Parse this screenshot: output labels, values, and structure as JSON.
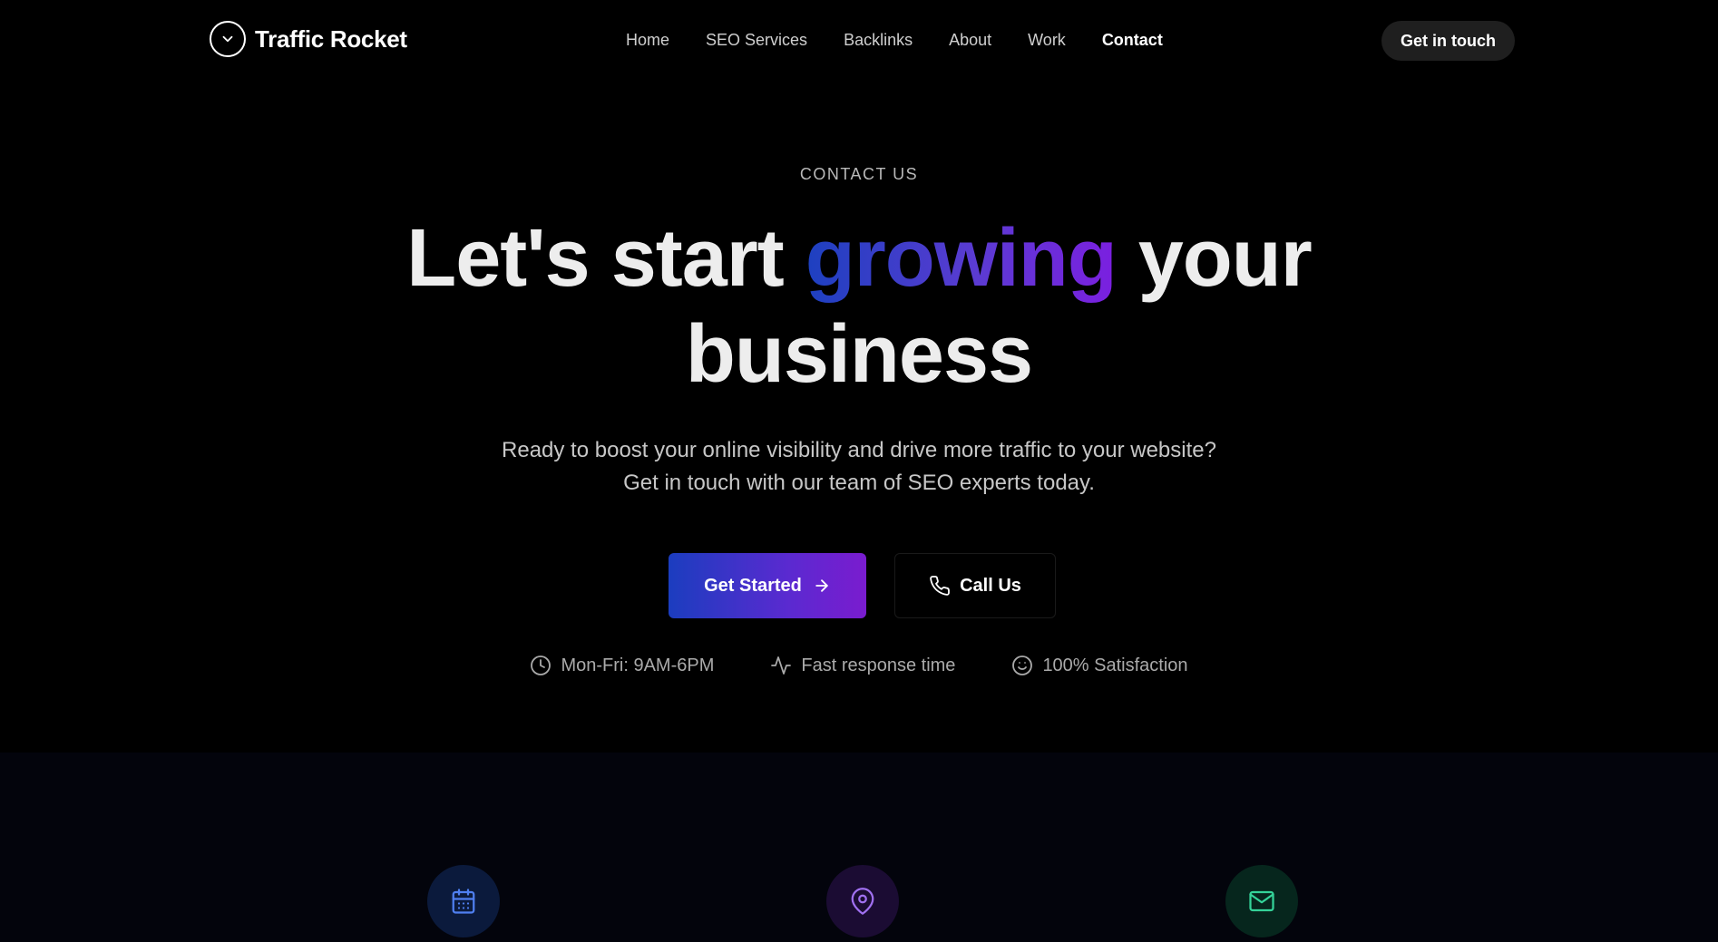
{
  "brand": {
    "name": "Traffic Rocket",
    "icon": "chevron-down-circle-icon"
  },
  "nav": {
    "links": [
      "Home",
      "SEO Services",
      "Backlinks",
      "About",
      "Work",
      "Contact"
    ],
    "active": "Contact",
    "cta_label": "Get in touch"
  },
  "hero": {
    "eyebrow": "CONTACT US",
    "headline_prefix": "Let's start ",
    "headline_highlight": "growing",
    "headline_suffix_1": " your",
    "headline_line2": "business",
    "subtitle_line1": "Ready to boost your online visibility and drive more traffic to your website?",
    "subtitle_line2": "Get in touch with our team of SEO experts today.",
    "primary_button": "Get Started",
    "secondary_button": "Call Us",
    "meta": [
      {
        "icon": "clock-icon",
        "label": "Mon-Fri: 9AM-6PM"
      },
      {
        "icon": "activity-icon",
        "label": "Fast response time"
      },
      {
        "icon": "smile-icon",
        "label": "100% Satisfaction"
      }
    ]
  },
  "features": {
    "icons": [
      "calendar-icon",
      "map-pin-icon",
      "mail-icon"
    ]
  },
  "colors": {
    "accent_blue": "#1d40c0",
    "accent_purple": "#7b1fe0",
    "background": "#000000",
    "section_bg": "#03040c"
  }
}
